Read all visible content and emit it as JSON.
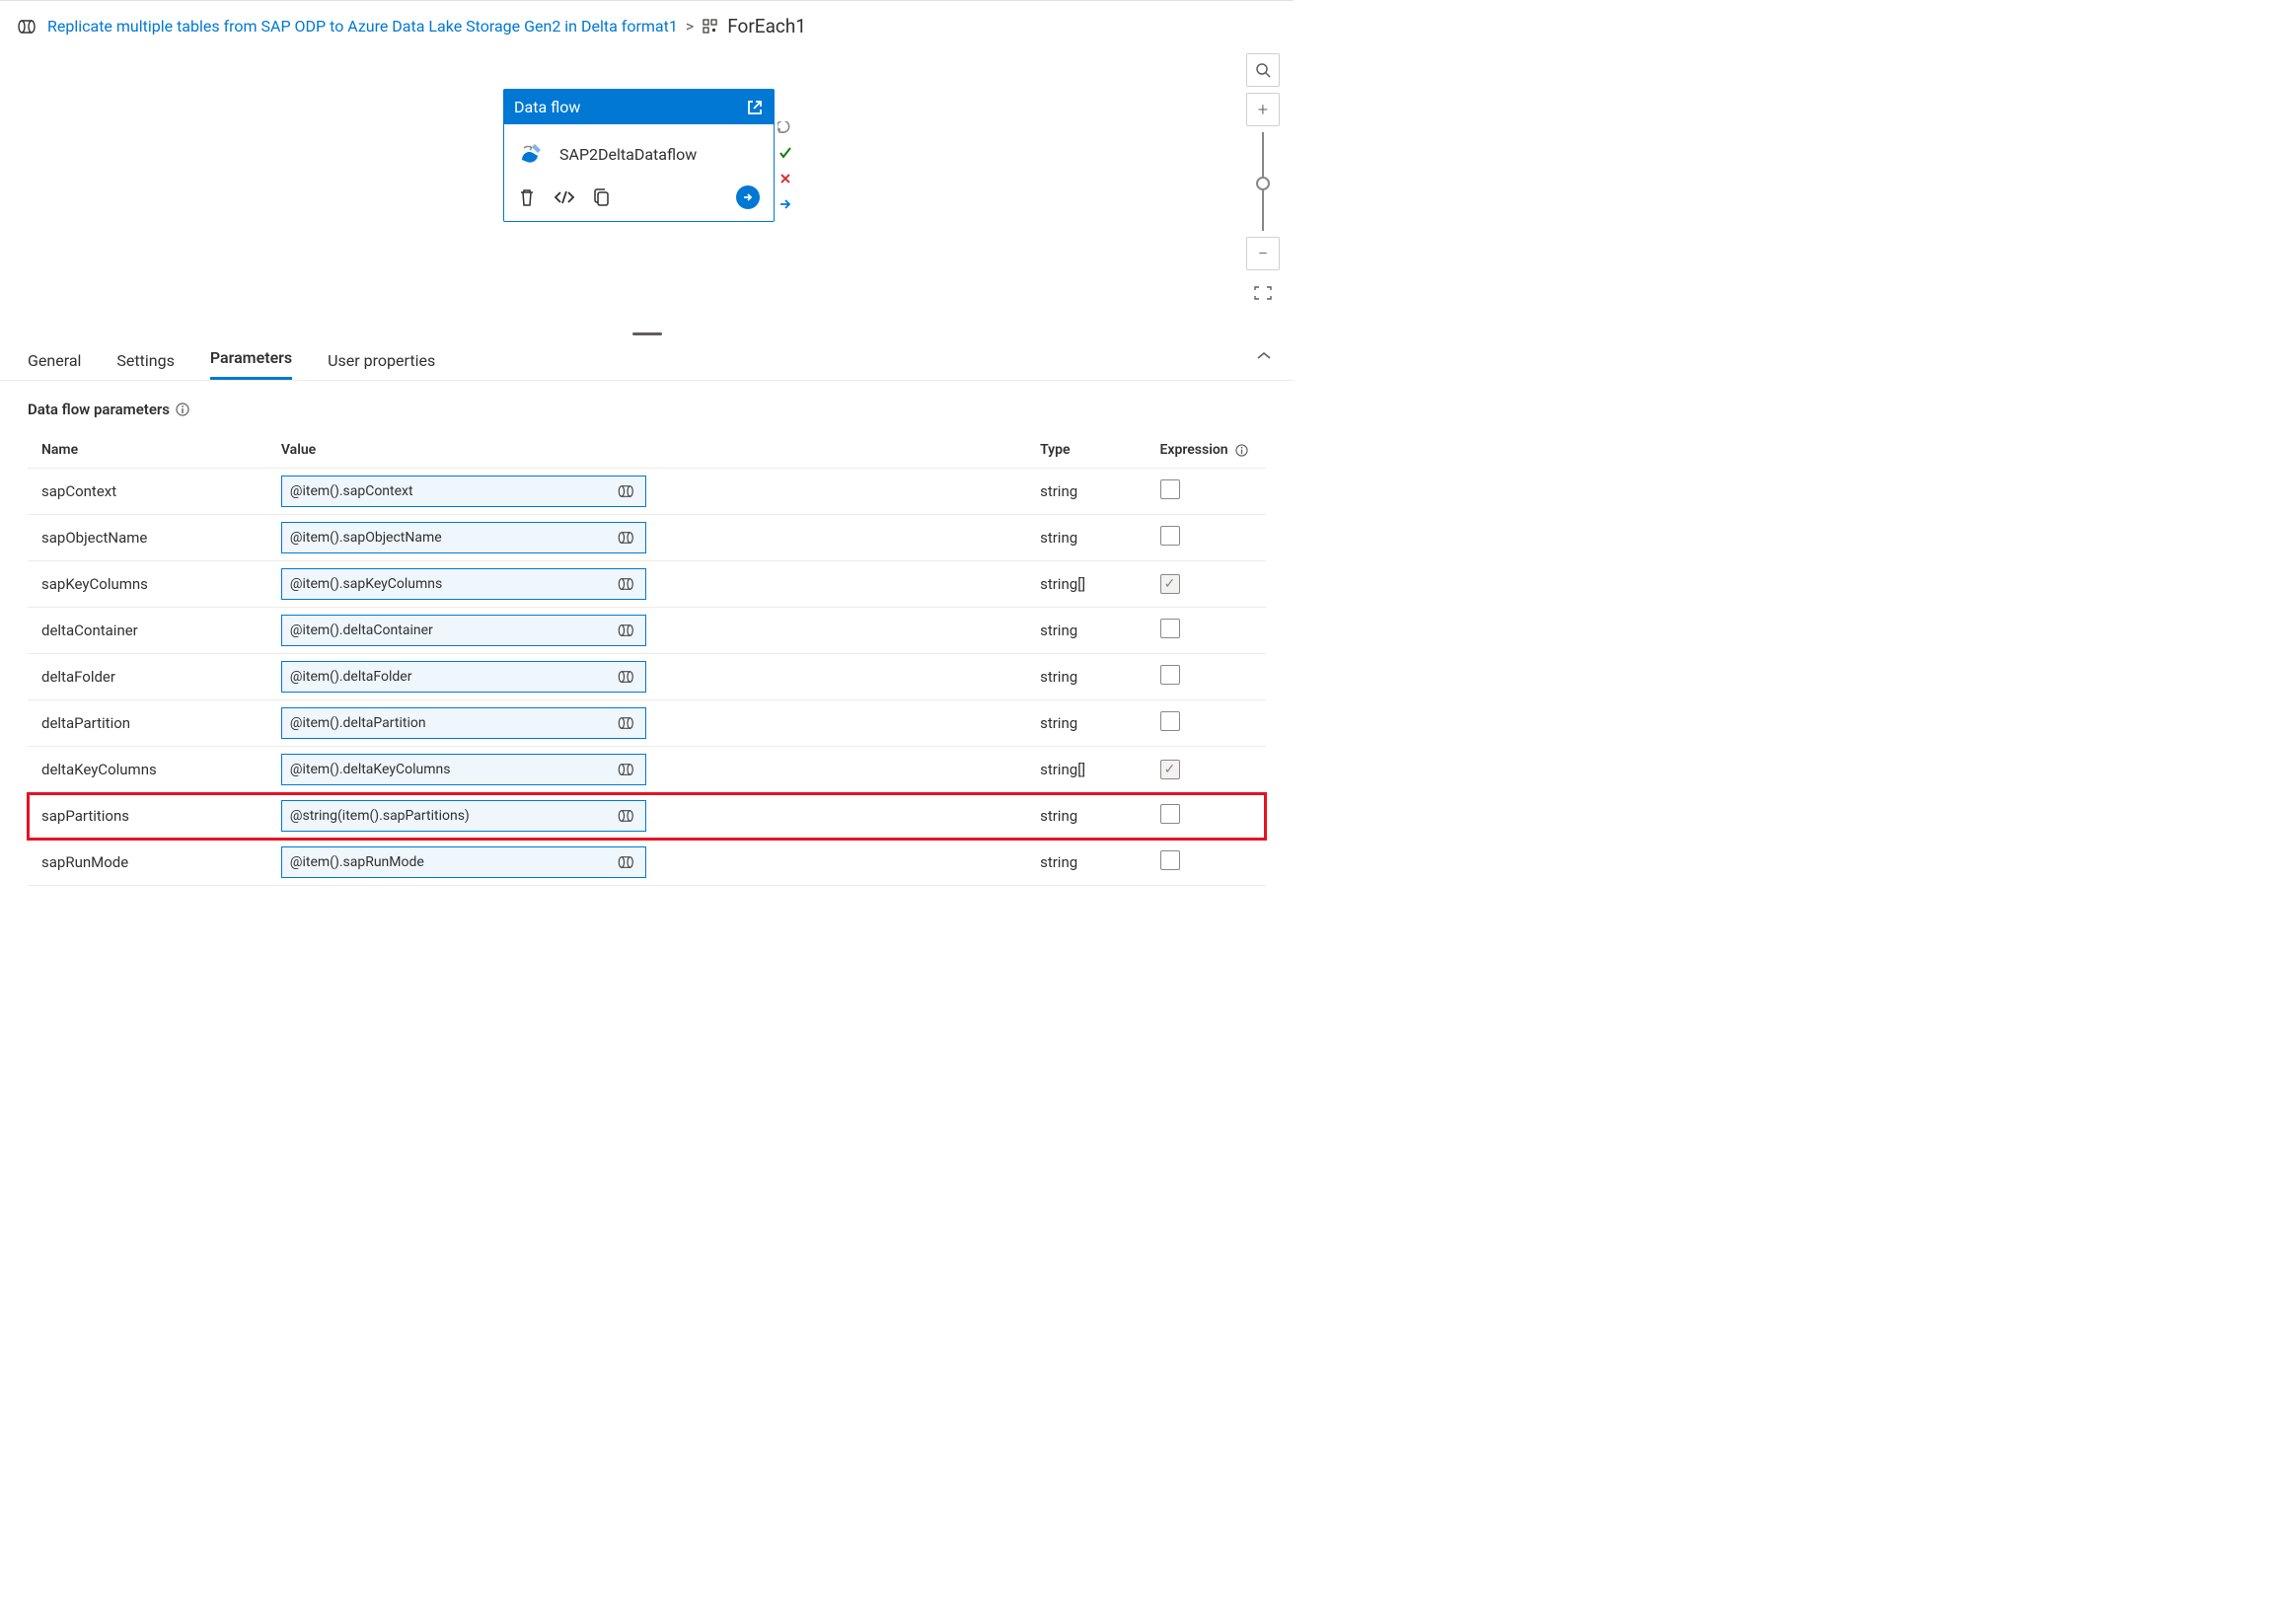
{
  "breadcrumb": {
    "link_text": "Replicate multiple tables from SAP ODP to Azure Data Lake Storage Gen2 in Delta format1",
    "current": "ForEach1"
  },
  "card": {
    "header": "Data flow",
    "name": "SAP2DeltaDataflow"
  },
  "tabs": [
    "General",
    "Settings",
    "Parameters",
    "User properties"
  ],
  "active_tab": "Parameters",
  "section_title": "Data flow parameters",
  "columns": {
    "name": "Name",
    "value": "Value",
    "type": "Type",
    "expression": "Expression"
  },
  "params": [
    {
      "name": "sapContext",
      "value": "@item().sapContext",
      "type": "string",
      "expr_checked": false,
      "highlight": false
    },
    {
      "name": "sapObjectName",
      "value": "@item().sapObjectName",
      "type": "string",
      "expr_checked": false,
      "highlight": false
    },
    {
      "name": "sapKeyColumns",
      "value": "@item().sapKeyColumns",
      "type": "string[]",
      "expr_checked": true,
      "highlight": false
    },
    {
      "name": "deltaContainer",
      "value": "@item().deltaContainer",
      "type": "string",
      "expr_checked": false,
      "highlight": false
    },
    {
      "name": "deltaFolder",
      "value": "@item().deltaFolder",
      "type": "string",
      "expr_checked": false,
      "highlight": false
    },
    {
      "name": "deltaPartition",
      "value": "@item().deltaPartition",
      "type": "string",
      "expr_checked": false,
      "highlight": false
    },
    {
      "name": "deltaKeyColumns",
      "value": "@item().deltaKeyColumns",
      "type": "string[]",
      "expr_checked": true,
      "highlight": false
    },
    {
      "name": "sapPartitions",
      "value": "@string(item().sapPartitions)",
      "type": "string",
      "expr_checked": false,
      "highlight": true
    },
    {
      "name": "sapRunMode",
      "value": "@item().sapRunMode",
      "type": "string",
      "expr_checked": false,
      "highlight": false
    }
  ]
}
